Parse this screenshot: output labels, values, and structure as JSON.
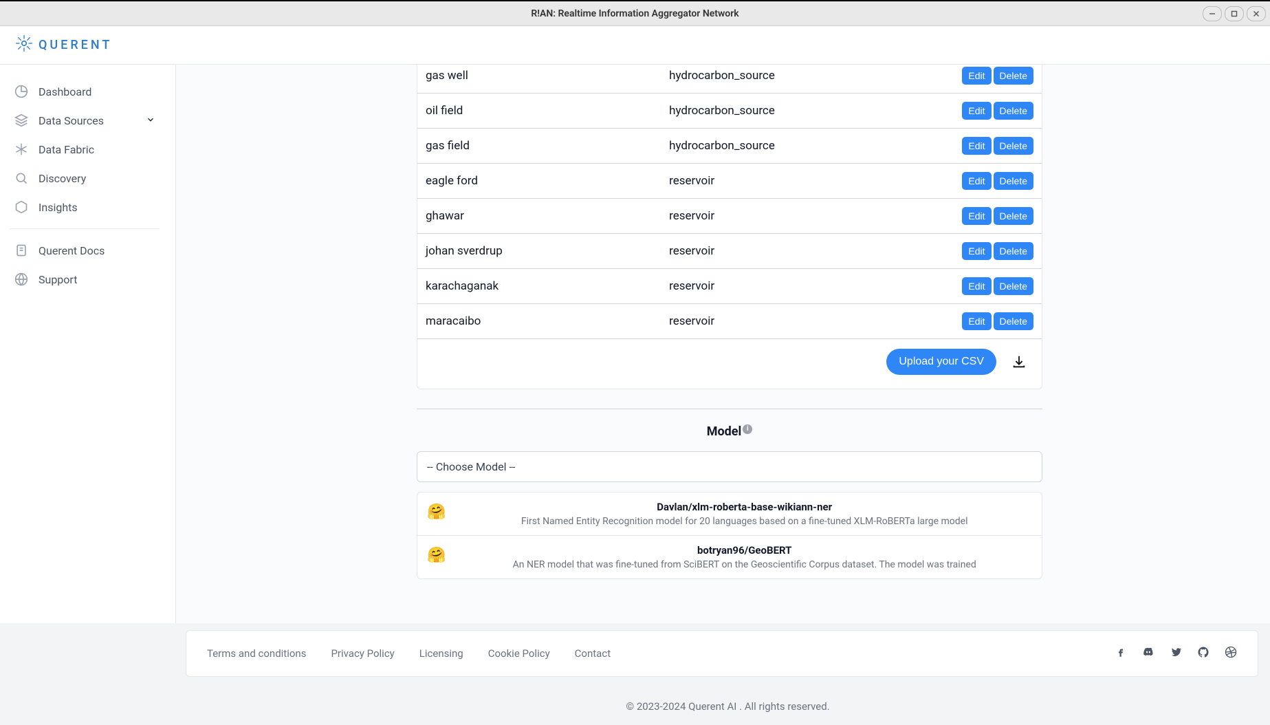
{
  "os": {
    "title": "R!AN: Realtime Information Aggregator Network"
  },
  "brand": "QUERENT",
  "sidebar": {
    "items": [
      {
        "label": "Dashboard",
        "icon": "dashboard"
      },
      {
        "label": "Data Sources",
        "icon": "layers",
        "expandable": true
      },
      {
        "label": "Data Fabric",
        "icon": "snowflake"
      },
      {
        "label": "Discovery",
        "icon": "search"
      },
      {
        "label": "Insights",
        "icon": "hex"
      }
    ],
    "secondary": [
      {
        "label": "Querent Docs",
        "icon": "doc"
      },
      {
        "label": "Support",
        "icon": "globe"
      }
    ]
  },
  "table": {
    "rows": [
      {
        "name": "gas well",
        "type": "hydrocarbon_source"
      },
      {
        "name": "oil field",
        "type": "hydrocarbon_source"
      },
      {
        "name": "gas field",
        "type": "hydrocarbon_source"
      },
      {
        "name": "eagle ford",
        "type": "reservoir"
      },
      {
        "name": "ghawar",
        "type": "reservoir"
      },
      {
        "name": "johan sverdrup",
        "type": "reservoir"
      },
      {
        "name": "karachaganak",
        "type": "reservoir"
      },
      {
        "name": "maracaibo",
        "type": "reservoir"
      }
    ],
    "edit_label": "Edit",
    "delete_label": "Delete",
    "upload_label": "Upload your CSV"
  },
  "model": {
    "heading": "Model",
    "placeholder": "-- Choose Model --",
    "options": [
      {
        "name": "Davlan/xlm-roberta-base-wikiann-ner",
        "desc": "First Named Entity Recognition model for 20 languages based on a fine-tuned XLM-RoBERTa large model"
      },
      {
        "name": "botryan96/GeoBERT",
        "desc": "An NER model that was fine-tuned from SciBERT on the Geoscientific Corpus dataset. The model was trained"
      }
    ]
  },
  "footer": {
    "links": [
      "Terms and conditions",
      "Privacy Policy",
      "Licensing",
      "Cookie Policy",
      "Contact"
    ],
    "copyright": "© 2023-2024 Querent AI . All rights reserved."
  }
}
